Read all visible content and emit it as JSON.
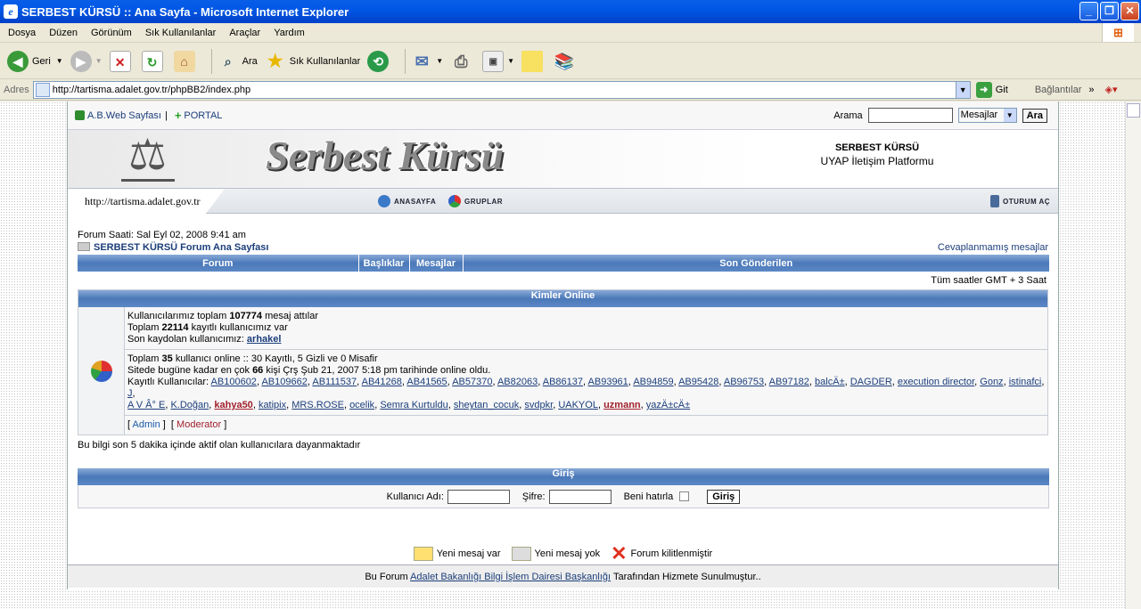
{
  "window": {
    "title": "SERBEST KÜRSÜ :: Ana Sayfa - Microsoft Internet Explorer"
  },
  "menu": [
    "Dosya",
    "Düzen",
    "Görünüm",
    "Sık Kullanılanlar",
    "Araçlar",
    "Yardım"
  ],
  "toolbar": {
    "back": "Geri",
    "search": "Ara",
    "favorites": "Sık Kullanılanlar"
  },
  "address": {
    "label": "Adres",
    "url": "http://tartisma.adalet.gov.tr/phpBB2/index.php",
    "go": "Git",
    "links": "Bağlantılar"
  },
  "top": {
    "web": "A.B.Web Sayfası",
    "sep": "|",
    "portal": "PORTAL",
    "search_label": "Arama",
    "search_select": "Mesajlar",
    "search_btn": "Ara"
  },
  "banner": {
    "logo": "Serbest Kürsü",
    "site_title": "SERBEST KÜRSÜ",
    "site_desc": "UYAP İletişim Platformu"
  },
  "nav": {
    "url": "http://tartisma.adalet.gov.tr",
    "home": "ANASAYFA",
    "groups": "GRUPLAR",
    "login": "OTURUM AÇ"
  },
  "content": {
    "time": "Forum Saati: Sal Eyl 02, 2008 9:41 am",
    "index_link": "SERBEST KÜRSÜ Forum Ana Sayfası",
    "unanswered": "Cevaplanmamış mesajlar",
    "headers": {
      "forum": "Forum",
      "topics": "Başlıklar",
      "posts": "Mesajlar",
      "last": "Son Gönderilen"
    },
    "timezone": "Tüm saatler GMT + 3 Saat",
    "online_title": "Kimler Online",
    "stats": {
      "l1a": "Kullanıcılarımız toplam",
      "posts": "107774",
      "l1b": "mesaj attılar",
      "l2a": "Toplam",
      "users": "22114",
      "l2b": "kayıtlı kullanıcımız var",
      "l3a": "Son kaydolan kullanıcımız:",
      "newest": "arhakel"
    },
    "online": {
      "l1a": "Toplam",
      "count": "35",
      "l1b": "kullanıcı online :: 30 Kayıtlı, 5 Gizli ve 0 Misafir",
      "l2a": "Sitede bugüne kadar en çok",
      "max": "66",
      "l2b": "kişi Çrş Şub 21, 2007 5:18 pm tarihinde online oldu.",
      "reg_label": "Kayıtlı Kullanıcılar:"
    },
    "users_line1": [
      "AB100602",
      "AB109662",
      "AB111537",
      "AB41268",
      "AB41565",
      "AB57370",
      "AB82063",
      "AB86137",
      "AB93961",
      "AB94859",
      "AB95428",
      "AB96753",
      "AB97182",
      "balcÄ±",
      "DAGDER",
      "execution director",
      "Gonz",
      "istinafci",
      "J"
    ],
    "users_line2": [
      "A V Â° E",
      "K.Doğan",
      "kahya50",
      "katipix",
      "MRS.ROSE",
      "ocelik",
      "Semra Kurtuldu",
      "sheytan_cocuk",
      "svdpkr",
      "UAKYOL",
      "uzmann",
      "yazÄ±cÄ±"
    ],
    "legend_admin": "Admin",
    "legend_mod": "Moderator",
    "note": "Bu bilgi son 5 dakika içinde aktif olan kullanıcılara dayanmaktadır",
    "login_title": "Giriş",
    "username_label": "Kullanıcı Adı:",
    "password_label": "Şifre:",
    "remember_label": "Beni hatırla",
    "login_btn": "Giriş",
    "new_posts": "Yeni mesaj var",
    "no_new": "Yeni mesaj yok",
    "locked": "Forum kilitlenmiştir"
  },
  "footer": {
    "pre": "Bu Forum",
    "link": "Adalet Bakanlığı Bilgi İşlem Dairesi Başkanlığı",
    "post": "Tarafından Hizmete Sunulmuştur.."
  }
}
